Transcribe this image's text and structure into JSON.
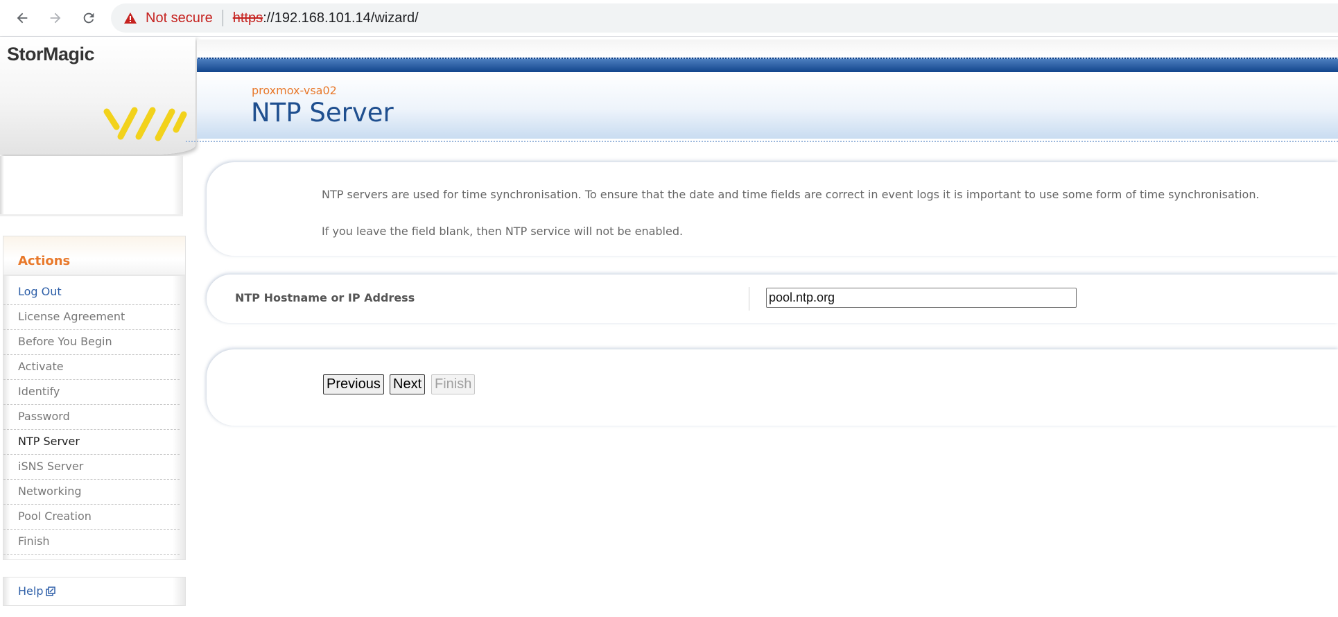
{
  "browser": {
    "not_secure": "Not secure",
    "url_scheme": "https",
    "url_rest": "://192.168.101.14/wizard/"
  },
  "brand": {
    "name": "StorMagic",
    "accent": "#f2d21b"
  },
  "header": {
    "host": "proxmox-vsa02",
    "title": "NTP Server"
  },
  "sidebar": {
    "actions_title": "Actions",
    "items": [
      {
        "label": "Log Out",
        "kind": "link"
      },
      {
        "label": "License Agreement",
        "kind": "step"
      },
      {
        "label": "Before You Begin",
        "kind": "step"
      },
      {
        "label": "Activate",
        "kind": "step"
      },
      {
        "label": "Identify",
        "kind": "step"
      },
      {
        "label": "Password",
        "kind": "step"
      },
      {
        "label": "NTP Server",
        "kind": "current"
      },
      {
        "label": "iSNS Server",
        "kind": "step"
      },
      {
        "label": "Networking",
        "kind": "step"
      },
      {
        "label": "Pool Creation",
        "kind": "step"
      },
      {
        "label": "Finish",
        "kind": "step"
      }
    ],
    "help": "Help"
  },
  "main": {
    "intro_1": "NTP servers are used for time synchronisation. To ensure that the date and time fields are correct in event logs it is important to use some form of time synchronisation.",
    "intro_2": "If you leave the field blank, then NTP service will not be enabled.",
    "field_label": "NTP Hostname or IP Address",
    "field_value": "pool.ntp.org"
  },
  "buttons": {
    "previous": "Previous",
    "next": "Next",
    "finish": "Finish"
  },
  "colors": {
    "title_blue": "#1f4f8f",
    "host_orange": "#e8792b",
    "link_blue": "#2e5fa8",
    "warning_red": "#c5221f"
  }
}
